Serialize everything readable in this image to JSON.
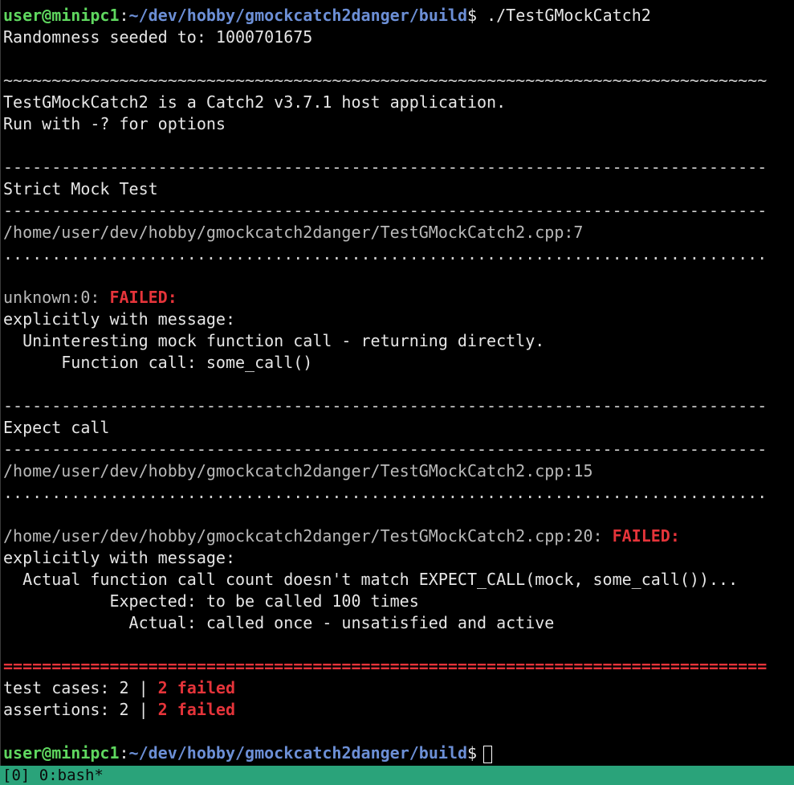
{
  "prompt": {
    "user_host": "user@minipc1",
    "colon": ":",
    "path": "~/dev/hobby/gmockcatch2danger/build",
    "dollar": "$"
  },
  "lines": {
    "cmd": " ./TestGMockCatch2",
    "seed": "Randomness seeded to: 1000701675",
    "tilde_sep": "~~~~~~~~~~~~~~~~~~~~~~~~~~~~~~~~~~~~~~~~~~~~~~~~~~~~~~~~~~~~~~~~~~~~~~~~~~~~~~~",
    "host_app": "TestGMockCatch2 is a Catch2 v3.7.1 host application.",
    "run_with": "Run with -? for options",
    "dash_sep": "-------------------------------------------------------------------------------",
    "dot_sep": "...............................................................................",
    "eq_sep": "===============================================================================",
    "test1_name": "Strict Mock Test",
    "test1_file": "/home/user/dev/hobby/gmockcatch2danger/TestGMockCatch2.cpp:7",
    "test1_loc": "unknown:0: ",
    "failed": "FAILED:",
    "explicit_msg": "explicitly with message:",
    "test1_msg1": "  Uninteresting mock function call - returning directly.",
    "test1_msg2": "      Function call: some_call()",
    "test2_name": "Expect call",
    "test2_file": "/home/user/dev/hobby/gmockcatch2danger/TestGMockCatch2.cpp:15",
    "test2_loc": "/home/user/dev/hobby/gmockcatch2danger/TestGMockCatch2.cpp:20: ",
    "test2_msg1": "  Actual function call count doesn't match EXPECT_CALL(mock, some_call())...",
    "test2_msg2": "           Expected: to be called 100 times",
    "test2_msg3": "             Actual: called once - unsatisfied and active",
    "summary_cases": "test cases: 2 | ",
    "summary_assertions": "assertions: 2 | ",
    "summary_failed": "2 failed"
  },
  "status_bar": {
    "text": "[0] 0:bash*"
  },
  "colors": {
    "background": "#000000",
    "prompt_user": "#5fd75f",
    "prompt_path": "#6c8fd6",
    "failed": "#e5343a",
    "status_bar": "#2aa37a"
  }
}
